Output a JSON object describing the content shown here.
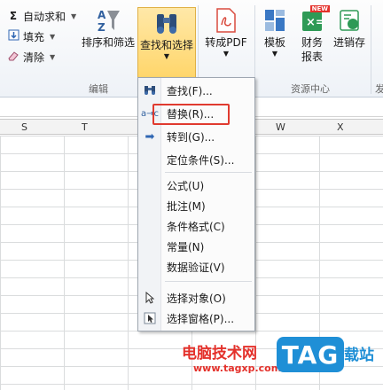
{
  "ribbon": {
    "autosum_label": "自动求和",
    "fill_label": "填充",
    "clear_label": "清除",
    "sort_filter_label": "排序和筛选",
    "find_select_label": "查找和选择",
    "to_pdf_label": "转成PDF",
    "template_label": "模板",
    "finance_label_line1": "财务",
    "finance_label_line2": "报表",
    "inventory_label": "进销存",
    "new_badge": "NEW",
    "group_edit": "编辑",
    "group_resources": "资源中心",
    "group_cut": "发"
  },
  "columns": [
    "S",
    "T",
    "W",
    "X"
  ],
  "menu": {
    "items": [
      {
        "label": "查找(F)...",
        "icon": "binoculars-icon"
      },
      {
        "label": "替换(R)...",
        "icon": "replace-icon"
      },
      {
        "label": "转到(G)...",
        "icon": "goto-arrow-icon"
      },
      {
        "label": "定位条件(S)...",
        "icon": ""
      },
      {
        "label": "公式(U)",
        "icon": ""
      },
      {
        "label": "批注(M)",
        "icon": ""
      },
      {
        "label": "条件格式(C)",
        "icon": ""
      },
      {
        "label": "常量(N)",
        "icon": ""
      },
      {
        "label": "数据验证(V)",
        "icon": ""
      },
      {
        "label": "选择对象(O)",
        "icon": "pointer-icon"
      },
      {
        "label": "选择窗格(P)...",
        "icon": "selection-pane-icon"
      }
    ]
  },
  "watermark": {
    "site_name": "电脑技术网",
    "url": "www.tagxp.com",
    "logo": "TAG",
    "tail": "载站"
  },
  "colors": {
    "highlight_border": "#e03a2f",
    "active_button": "#ffd66b",
    "watermark_blue": "#1f8fd6",
    "watermark_red": "#e4312b"
  }
}
